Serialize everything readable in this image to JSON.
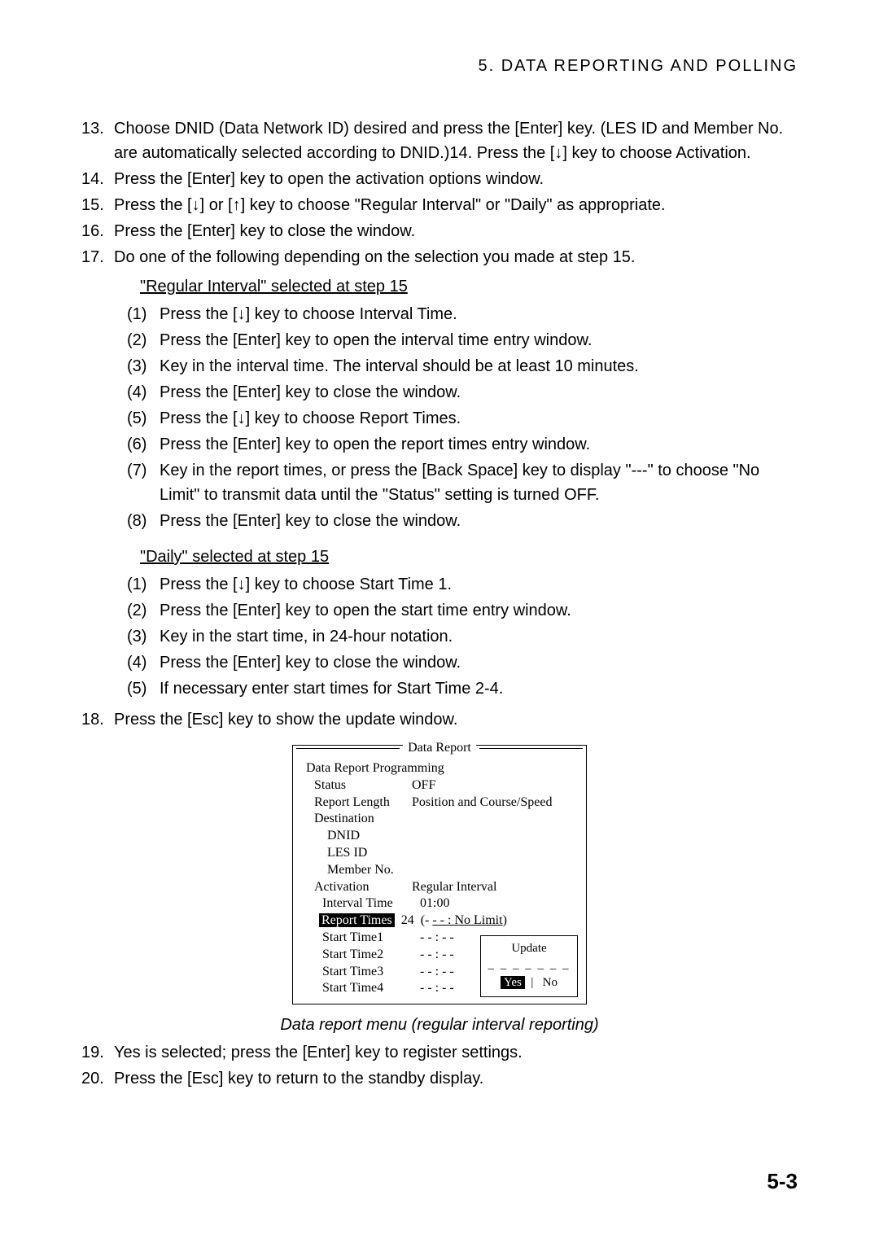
{
  "header": "5. DATA REPORTING AND POLLING",
  "items": {
    "i13": {
      "num": "13.",
      "text": "Choose DNID (Data Network ID) desired and press the [Enter] key. (LES ID and Member No. are automatically selected according to DNID.)14.  Press the [↓] key to choose Activation."
    },
    "i14": {
      "num": "14.",
      "text": "Press the [Enter] key to open the activation options window."
    },
    "i15": {
      "num": "15.",
      "text": "Press the [↓] or [↑] key to choose \"Regular Interval\" or \"Daily\" as appropriate."
    },
    "i16": {
      "num": "16.",
      "text": "Press the [Enter] key to close the window."
    },
    "i17": {
      "num": "17.",
      "text": "Do one of the following depending on the selection you made at step 15."
    },
    "i18": {
      "num": "18.",
      "text": "Press the [Esc] key to show the update window."
    },
    "i19": {
      "num": "19.",
      "text": "Yes is selected; press the [Enter] key to register settings."
    },
    "i20": {
      "num": "20.",
      "text": "Press the [Esc] key to return to the standby display."
    }
  },
  "section_a_title": "\"Regular Interval\" selected at step 15",
  "section_a": {
    "s1": {
      "num": "(1)",
      "text": "Press the [↓] key to choose Interval Time."
    },
    "s2": {
      "num": "(2)",
      "text": "Press the [Enter] key to open the interval time entry window."
    },
    "s3": {
      "num": "(3)",
      "text": "Key in the interval time. The interval should be at least 10 minutes."
    },
    "s4": {
      "num": "(4)",
      "text": "Press the [Enter] key to close the window."
    },
    "s5": {
      "num": "(5)",
      "text": "Press the [↓] key to choose Report Times."
    },
    "s6": {
      "num": "(6)",
      "text": "Press the [Enter] key to open the report times entry window."
    },
    "s7": {
      "num": "(7)",
      "text": "Key in the report times, or press the [Back Space] key to display \"---\" to choose \"No Limit\" to transmit data until the \"Status\" setting is turned OFF."
    },
    "s8": {
      "num": "(8)",
      "text": "Press the [Enter] key to close the window."
    }
  },
  "section_b_title": "\"Daily\" selected at step 15",
  "section_b": {
    "s1": {
      "num": "(1)",
      "text": "Press the [↓] key to choose Start Time 1."
    },
    "s2": {
      "num": "(2)",
      "text": "Press the [Enter] key to open the start time entry window."
    },
    "s3": {
      "num": "(3)",
      "text": "Key in the start time, in 24-hour notation."
    },
    "s4": {
      "num": "(4)",
      "text": "Press the [Enter] key to close the window."
    },
    "s5": {
      "num": "(5)",
      "text": "If necessary enter start times for Start Time 2-4."
    }
  },
  "figure": {
    "title": "Data Report",
    "heading": "Data Report Programming",
    "rows": {
      "status_l": "Status",
      "status_v": "OFF",
      "rlen_l": "Report Length",
      "rlen_v": "Position and Course/Speed",
      "dest_l": "Destination",
      "dnid_l": "DNID",
      "les_l": "LES ID",
      "mem_l": "Member No.",
      "act_l": "Activation",
      "act_v": "Regular Interval",
      "int_l": "Interval Time",
      "int_v": "01:00",
      "rep_l": "Report Times",
      "rep_v": "  24  (- ",
      "rep_link": "- - : No Limit",
      "rep_close": ")",
      "st1_l": "Start Time1",
      "st1_v": "- - : - -",
      "st2_l": "Start Time2",
      "st2_v": "- - : - -",
      "st3_l": "Start Time3",
      "st3_v": "- - : - -",
      "st4_l": "Start Time4",
      "st4_v": "- - : - -"
    },
    "update": {
      "title": "Update",
      "sep": "_ _ _ _ _ _ _",
      "yes": "Yes",
      "no": "No"
    }
  },
  "caption": "Data report menu (regular interval reporting)",
  "page_num": "5-3"
}
